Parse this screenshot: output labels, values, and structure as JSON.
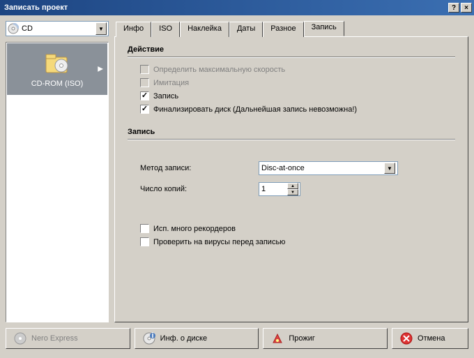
{
  "window": {
    "title": "Записать проект"
  },
  "media_selector": {
    "value": "CD"
  },
  "compilation": {
    "items": [
      {
        "label": "CD-ROM (ISO)"
      }
    ]
  },
  "tabs": {
    "items": [
      {
        "label": "Инфо"
      },
      {
        "label": "ISO"
      },
      {
        "label": "Наклейка"
      },
      {
        "label": "Даты"
      },
      {
        "label": "Разное"
      },
      {
        "label": "Запись"
      }
    ],
    "active": 5
  },
  "action_group": {
    "title": "Действие",
    "determine_speed": {
      "label": "Определить максимальную скорость",
      "checked": false,
      "enabled": false
    },
    "simulate": {
      "label": "Имитация",
      "checked": false,
      "enabled": false
    },
    "write": {
      "label": "Запись",
      "checked": true,
      "enabled": true
    },
    "finalize": {
      "label": "Финализировать диск (Дальнейшая запись невозможна!)",
      "checked": true,
      "enabled": true
    }
  },
  "write_group": {
    "title": "Запись",
    "method_label": "Метод записи:",
    "method_value": "Disc-at-once",
    "copies_label": "Число копий:",
    "copies_value": "1",
    "multi_recorder": {
      "label": "Исп. много рекордеров",
      "checked": false
    },
    "virus_check": {
      "label": "Проверить на вирусы перед записью",
      "checked": false
    }
  },
  "buttons": {
    "nero_express": "Nero Express",
    "disc_info": "Инф. о диске",
    "burn": "Прожиг",
    "cancel": "Отмена"
  }
}
